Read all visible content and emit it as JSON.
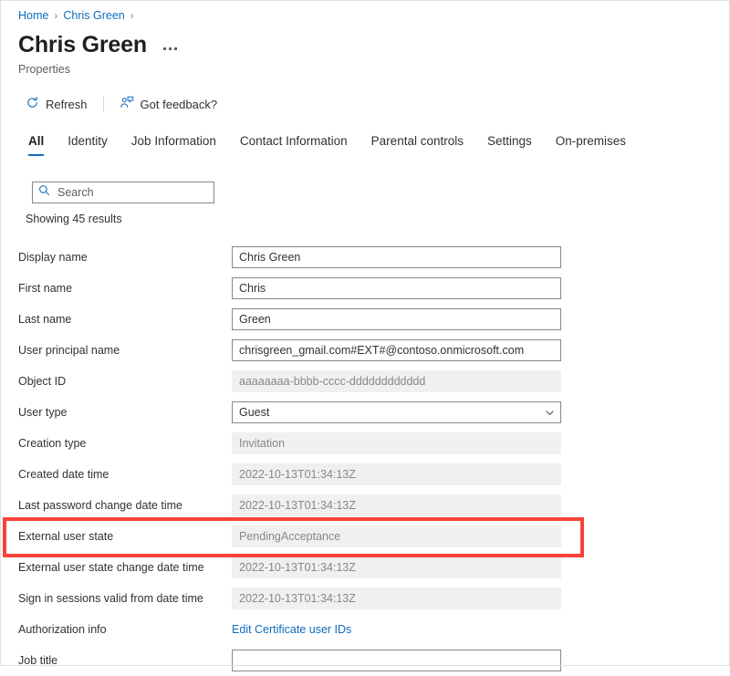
{
  "breadcrumb": {
    "items": [
      {
        "label": "Home"
      },
      {
        "label": "Chris Green"
      }
    ],
    "separator": "›"
  },
  "header": {
    "title": "Chris Green",
    "subtitle": "Properties",
    "more_menu": "···"
  },
  "commandbar": {
    "refresh_label": "Refresh",
    "refresh_icon": "refresh-icon",
    "feedback_label": "Got feedback?",
    "feedback_icon": "feedback-person-icon"
  },
  "tabs": [
    {
      "label": "All",
      "active": true
    },
    {
      "label": "Identity",
      "active": false
    },
    {
      "label": "Job Information",
      "active": false
    },
    {
      "label": "Contact Information",
      "active": false
    },
    {
      "label": "Parental controls",
      "active": false
    },
    {
      "label": "Settings",
      "active": false
    },
    {
      "label": "On-premises",
      "active": false
    }
  ],
  "search": {
    "placeholder": "Search",
    "value": "",
    "icon": "search-icon"
  },
  "results": {
    "text": "Showing 45 results"
  },
  "properties": [
    {
      "label": "Display name",
      "value": "Chris Green",
      "kind": "input"
    },
    {
      "label": "First name",
      "value": "Chris",
      "kind": "input"
    },
    {
      "label": "Last name",
      "value": "Green",
      "kind": "input"
    },
    {
      "label": "User principal name",
      "value": "chrisgreen_gmail.com#EXT#@contoso.onmicrosoft.com",
      "kind": "input"
    },
    {
      "label": "Object ID",
      "value": "aaaaaaaa-bbbb-cccc-dddddddddddd",
      "kind": "disabled"
    },
    {
      "label": "User type",
      "value": "Guest",
      "kind": "select"
    },
    {
      "label": "Creation type",
      "value": "Invitation",
      "kind": "disabled"
    },
    {
      "label": "Created date time",
      "value": "2022-10-13T01:34:13Z",
      "kind": "disabled"
    },
    {
      "label": "Last password change date time",
      "value": "2022-10-13T01:34:13Z",
      "kind": "disabled"
    },
    {
      "label": "External user state",
      "value": "PendingAcceptance",
      "kind": "disabled"
    },
    {
      "label": "External user state change date time",
      "value": "2022-10-13T01:34:13Z",
      "kind": "disabled"
    },
    {
      "label": "Sign in sessions valid from date time",
      "value": "2022-10-13T01:34:13Z",
      "kind": "disabled"
    },
    {
      "label": "Authorization info",
      "value": "Edit Certificate user IDs",
      "kind": "link"
    },
    {
      "label": "Job title",
      "value": "",
      "kind": "input"
    }
  ],
  "highlight": {
    "target_label": "External user state",
    "color": "#f9423a"
  },
  "colors": {
    "accent": "#0f6cbd",
    "link": "#0f6cbd",
    "text": "#323130",
    "muted": "#605e5c",
    "disabled_bg": "#f0f0ef",
    "highlight": "#f9423a"
  }
}
